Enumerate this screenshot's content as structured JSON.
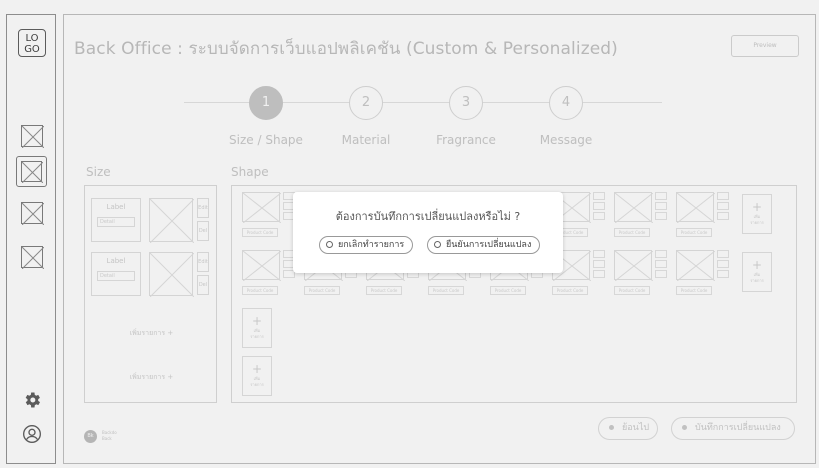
{
  "sidebar": {
    "logo_text": "LO\nGO",
    "icons": [
      "image-placeholder-icon",
      "image-placeholder-icon",
      "image-placeholder-icon",
      "image-placeholder-icon",
      "gear-icon",
      "user-icon"
    ]
  },
  "header": {
    "title": "Back Office : ระบบจัดการเว็บแอปพลิเคชัน (Custom & Personalized)",
    "preview_label": "Preview"
  },
  "steps": [
    {
      "number": "1",
      "label": "Size / Shape",
      "active": true
    },
    {
      "number": "2",
      "label": "Material",
      "active": false
    },
    {
      "number": "3",
      "label": "Fragrance",
      "active": false
    },
    {
      "number": "4",
      "label": "Message",
      "active": false
    }
  ],
  "size_section": {
    "label": "Size",
    "rows": [
      {
        "label": "Label",
        "detail": "Detail",
        "side_a": "Edit",
        "side_b": "Del"
      },
      {
        "label": "Label",
        "detail": "Detail",
        "side_a": "Edit",
        "side_b": "Del"
      }
    ],
    "add_labels": [
      "เพิ่มรายการ  +",
      "เพิ่มรายการ  +"
    ]
  },
  "shape_section": {
    "label": "Shape",
    "product_code": "Product Code",
    "add_label": "เพิ่ม\nรายการ"
  },
  "footer": {
    "fab_text": "Bk",
    "fab_caption": "Backdo\nBack",
    "back_label": "ย้อนไป",
    "save_label": "บันทึกการเปลี่ยนแปลง"
  },
  "dialog": {
    "question": "ต้องการบันทึกการเปลี่ยนแปลงหรือไม่ ?",
    "cancel_label": "ยกเลิกทำรายการ",
    "confirm_label": "ยืนยันการเปลี่ยนแปลง"
  },
  "colors": {
    "active_step": "#c5c5c5",
    "border": "#d9d9d9",
    "dialog_bg": "#ffffff"
  }
}
